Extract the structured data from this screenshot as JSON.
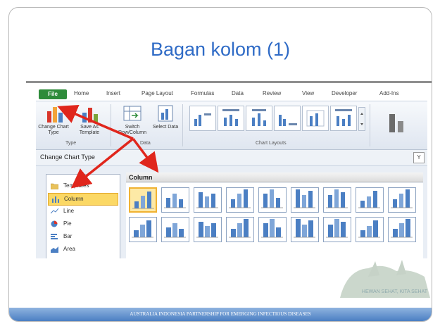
{
  "slide": {
    "title": "Bagan kolom (1)",
    "footer": "AUSTRALIA INDONESIA PARTNERSHIP FOR EMERGING INFECTIOUS DISEASES",
    "watermark_text": "HEWAN SEHAT, KITA SEHAT"
  },
  "ribbon": {
    "tabs": [
      "File",
      "Home",
      "Insert",
      "Page Layout",
      "Formulas",
      "Data",
      "Review",
      "View",
      "Developer",
      "Add-Ins"
    ],
    "buttons": {
      "change_chart_type": "Change Chart Type",
      "save_as_template": "Save As Template",
      "switch_row_column": "Switch Row/Column",
      "select_data": "Select Data"
    },
    "groups": {
      "type": "Type",
      "data": "Data",
      "chart_layouts": "Chart Layouts"
    }
  },
  "dialog": {
    "title": "Change Chart Type",
    "close_glyph": "Y",
    "categories": [
      "Templates",
      "Column",
      "Line",
      "Pie",
      "Bar",
      "Area"
    ],
    "selected_category": "Column",
    "gallery_header": "Column",
    "tile_count": 18
  },
  "colors": {
    "accent": "#2f6bc6",
    "selection": "#fbd865",
    "arrow": "#e0261c",
    "file_tab": "#2e8b3a"
  }
}
